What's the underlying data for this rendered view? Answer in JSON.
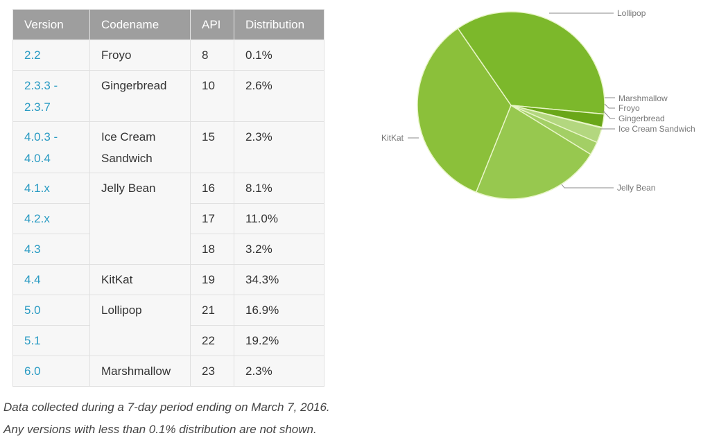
{
  "table": {
    "headers": [
      "Version",
      "Codename",
      "API",
      "Distribution"
    ],
    "rows": [
      {
        "version": [
          "2.2"
        ],
        "codename": [
          "Froyo"
        ],
        "api": "8",
        "dist": "0.1%"
      },
      {
        "version": [
          "2.3.3 -",
          "2.3.7"
        ],
        "codename": [
          "Gingerbread"
        ],
        "api": "10",
        "dist": "2.6%"
      },
      {
        "version": [
          "4.0.3 -",
          "4.0.4"
        ],
        "codename": [
          "Ice Cream",
          "Sandwich"
        ],
        "api": "15",
        "dist": "2.3%"
      },
      {
        "version": [
          "4.1.x"
        ],
        "codename": [
          "Jelly Bean"
        ],
        "api": "16",
        "dist": "8.1%"
      },
      {
        "version": [
          "4.2.x"
        ],
        "api": "17",
        "dist": "11.0%"
      },
      {
        "version": [
          "4.3"
        ],
        "api": "18",
        "dist": "3.2%"
      },
      {
        "version": [
          "4.4"
        ],
        "codename": [
          "KitKat"
        ],
        "api": "19",
        "dist": "34.3%"
      },
      {
        "version": [
          "5.0"
        ],
        "codename": [
          "Lollipop"
        ],
        "api": "21",
        "dist": "16.9%"
      },
      {
        "version": [
          "5.1"
        ],
        "api": "22",
        "dist": "19.2%"
      },
      {
        "version": [
          "6.0"
        ],
        "codename": [
          "Marshmallow"
        ],
        "api": "23",
        "dist": "2.3%"
      }
    ]
  },
  "notes": [
    "Data collected during a 7-day period ending on March 7, 2016.",
    "Any versions with less than 0.1% distribution are not shown."
  ],
  "chart_data": {
    "type": "pie",
    "title": "",
    "slices": [
      {
        "label": "Lollipop",
        "value": 36.1,
        "color": "#7cb82b"
      },
      {
        "label": "Marshmallow",
        "value": 2.3,
        "color": "#6aa719"
      },
      {
        "label": "Froyo",
        "value": 0.1,
        "color": "#c4df9b"
      },
      {
        "label": "Gingerbread",
        "value": 2.6,
        "color": "#b3d77f"
      },
      {
        "label": "Ice Cream Sandwich",
        "value": 2.3,
        "color": "#a3cf65"
      },
      {
        "label": "Jelly Bean",
        "value": 22.3,
        "color": "#97c84f"
      },
      {
        "label": "KitKat",
        "value": 34.3,
        "color": "#8bc03a"
      }
    ],
    "start_direction": "clockwise from east-north-east",
    "legend": "callout-labels"
  }
}
